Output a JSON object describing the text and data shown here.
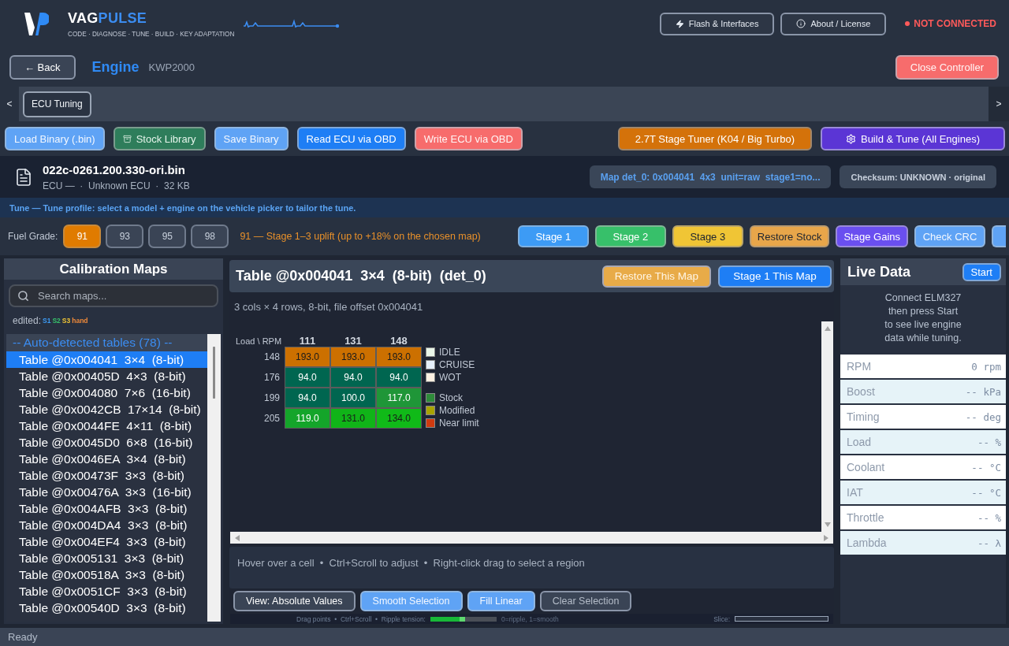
{
  "header": {
    "brand_primary": "VAG",
    "brand_accent": "PULSE",
    "tagline": "CODE · DIAGNOSE · TUNE · BUILD · KEY ADAPTATION",
    "flash_button": "Flash & Interfaces",
    "about_button": "About / License",
    "connection": {
      "text": "NOT CONNECTED",
      "connected": false
    }
  },
  "module_bar": {
    "back_button": {
      "label": "← Back",
      "kind": "dark"
    },
    "module": "Engine",
    "protocol": "KWP2000",
    "close_button": {
      "label": "Close Controller",
      "kind": "red"
    }
  },
  "tab_strip": {
    "scroll_left": "<",
    "scroll_right": ">",
    "tabs": [
      {
        "label": "ECU Tuning",
        "selected": true
      }
    ]
  },
  "file_actions": [
    {
      "label": "Load Binary (.bin)",
      "kind": "sky"
    },
    {
      "label": "Stock Library",
      "kind": "green"
    },
    {
      "label": "Save Binary",
      "kind": "sky"
    },
    {
      "label": "Read ECU via OBD",
      "kind": "blue"
    },
    {
      "label": "Write ECU via OBD",
      "kind": "red"
    }
  ],
  "tuner_actions": [
    {
      "label": "2.7T Stage Tuner (K04 / Big Turbo)",
      "kind": "orange"
    },
    {
      "label": "Build & Tune (All Engines)",
      "kind": "purple"
    }
  ],
  "file": {
    "name": "022c-0261.200.330-ori.bin",
    "meta": "ECU —  ·  Unknown ECU  ·  32 KB",
    "map_summary": "Map det_0: 0x004041  4x3  unit=raw  stage1=no...",
    "checksum": "Checksum: UNKNOWN · original"
  },
  "tune_notice": "Tune — Tune profile: select a model + engine on the vehicle picker to tailor the tune.",
  "fuel": {
    "label": "Fuel Grade:",
    "grades": [
      {
        "label": "91",
        "selected": true
      },
      {
        "label": "93",
        "selected": false
      },
      {
        "label": "95",
        "selected": false
      },
      {
        "label": "98",
        "selected": false
      }
    ],
    "description": "91 — Stage 1–3 uplift (up to +18% on the chosen map)",
    "stage_buttons": [
      {
        "label": "Stage 1",
        "kind": "azure"
      },
      {
        "label": "Stage 2",
        "kind": "emerald"
      },
      {
        "label": "Stage 3",
        "kind": "yellow"
      },
      {
        "label": "Restore Stock",
        "kind": "amber"
      },
      {
        "label": "Stage Gains",
        "kind": "violet"
      },
      {
        "label": "Check CRC",
        "kind": "sky"
      }
    ]
  },
  "maps_panel": {
    "title": "Calibration Maps",
    "search": {
      "placeholder": "Search maps..."
    },
    "edited_label": "edited:",
    "edited_tags": [
      {
        "label": "S1",
        "color": "#3d9bf5"
      },
      {
        "label": "S2",
        "color": "#37c06a"
      },
      {
        "label": "S3",
        "color": "#f0c535"
      },
      {
        "label": "hand",
        "color": "#f08a3a"
      }
    ],
    "group": "-- Auto-detected tables (78) --",
    "items": [
      {
        "label": "Table @0x004041  3×4  (8-bit)",
        "selected": true
      },
      {
        "label": "Table @0x00405D  4×3  (8-bit)",
        "selected": false
      },
      {
        "label": "Table @0x004080  7×6  (16-bit)",
        "selected": false
      },
      {
        "label": "Table @0x0042CB  17×14  (8-bit)",
        "selected": false
      },
      {
        "label": "Table @0x0044FE  4×11  (8-bit)",
        "selected": false
      },
      {
        "label": "Table @0x0045D0  6×8  (16-bit)",
        "selected": false
      },
      {
        "label": "Table @0x0046EA  3×4  (8-bit)",
        "selected": false
      },
      {
        "label": "Table @0x00473F  3×3  (8-bit)",
        "selected": false
      },
      {
        "label": "Table @0x00476A  3×3  (16-bit)",
        "selected": false
      },
      {
        "label": "Table @0x004AFB  3×3  (8-bit)",
        "selected": false
      },
      {
        "label": "Table @0x004DA4  3×3  (8-bit)",
        "selected": false
      },
      {
        "label": "Table @0x004EF4  3×3  (8-bit)",
        "selected": false
      },
      {
        "label": "Table @0x005131  3×3  (8-bit)",
        "selected": false
      },
      {
        "label": "Table @0x00518A  3×3  (8-bit)",
        "selected": false
      },
      {
        "label": "Table @0x0051CF  3×3  (8-bit)",
        "selected": false
      },
      {
        "label": "Table @0x00540D  3×3  (8-bit)",
        "selected": false
      }
    ]
  },
  "map_editor": {
    "title": "Table @0x004041  3×4  (8-bit)  (det_0)",
    "restore_button": {
      "label": "Restore This Map",
      "kind": "gold"
    },
    "stage_button": {
      "label": "Stage 1 This Map",
      "kind": "blue"
    },
    "subtitle": "3 cols × 4 rows, 8-bit, file offset 0x004041",
    "grid": {
      "corner": "Load \\ RPM",
      "columns": [
        "111",
        "131",
        "148"
      ],
      "rows": [
        {
          "label": "148",
          "cells": [
            {
              "value": "193.0",
              "color": "#cc7000"
            },
            {
              "value": "193.0",
              "color": "#cc7000"
            },
            {
              "value": "193.0",
              "color": "#cc7000"
            }
          ]
        },
        {
          "label": "176",
          "cells": [
            {
              "value": "94.0",
              "color": "#006650"
            },
            {
              "value": "94.0",
              "color": "#006650"
            },
            {
              "value": "94.0",
              "color": "#006650"
            }
          ]
        },
        {
          "label": "199",
          "cells": [
            {
              "value": "94.0",
              "color": "#006650"
            },
            {
              "value": "100.0",
              "color": "#006650"
            },
            {
              "value": "117.0",
              "color": "#1f9638"
            }
          ]
        },
        {
          "label": "205",
          "cells": [
            {
              "value": "119.0",
              "color": "#14a52a"
            },
            {
              "value": "131.0",
              "color": "#10b418"
            },
            {
              "value": "134.0",
              "color": "#10ba18"
            }
          ]
        }
      ]
    },
    "zone_legend": [
      {
        "label": "IDLE",
        "color": "#e8f5e8"
      },
      {
        "label": "CRUISE",
        "color": "#e6f0fb"
      },
      {
        "label": "WOT",
        "color": "#fdf1e2"
      }
    ],
    "status_legend": [
      {
        "label": "Stock",
        "color": "#2e8b3a"
      },
      {
        "label": "Modified",
        "color": "#a8a400"
      },
      {
        "label": "Near limit",
        "color": "#d03a10"
      }
    ],
    "hint": "Hover over a cell  •  Ctrl+Scroll to adjust  •  Right-click drag to select a region",
    "tools": [
      {
        "label": "View: Absolute Values",
        "kind": "dark"
      },
      {
        "label": "Smooth Selection",
        "kind": "sky"
      },
      {
        "label": "Fill Linear",
        "kind": "sky"
      },
      {
        "label": "Clear Selection",
        "kind": "ghost"
      }
    ],
    "curve_bar": {
      "hint": "Drag points  •  Ctrl+Scroll  •  Ripple tension:",
      "tension": {
        "level": 0.52
      },
      "tension_note": "0=ripple, 1=smooth",
      "slice_label": "Slice:"
    }
  },
  "live_data": {
    "title": "Live Data",
    "start_button": {
      "label": "Start",
      "kind": "blue"
    },
    "description": "Connect ELM327\nthen press Start\nto see live engine\ndata while tuning.",
    "readings": [
      {
        "label": "RPM",
        "value": "0 rpm"
      },
      {
        "label": "Boost",
        "value": "-- kPa"
      },
      {
        "label": "Timing",
        "value": "-- deg"
      },
      {
        "label": "Load",
        "value": "-- %"
      },
      {
        "label": "Coolant",
        "value": "-- °C"
      },
      {
        "label": "IAT",
        "value": "-- °C"
      },
      {
        "label": "Throttle",
        "value": "-- %"
      },
      {
        "label": "Lambda",
        "value": "-- λ"
      }
    ]
  },
  "status_bar": "Ready"
}
